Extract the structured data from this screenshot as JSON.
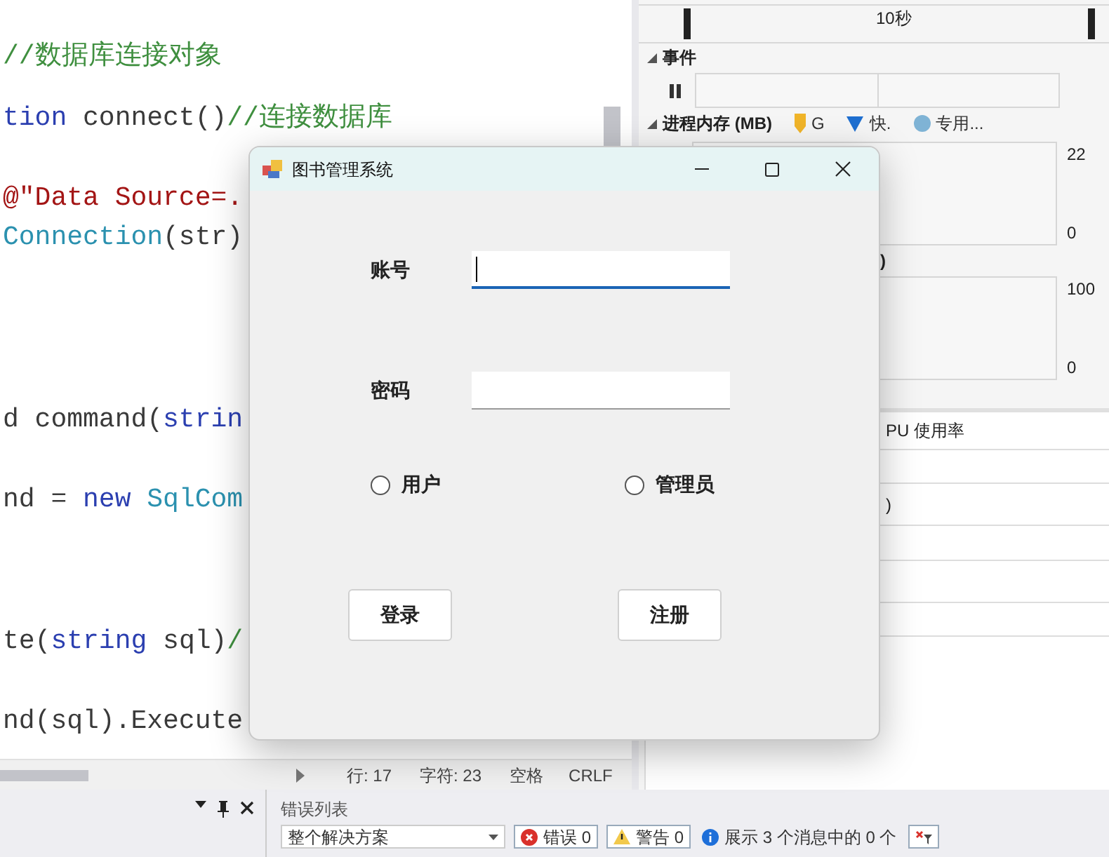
{
  "editor": {
    "lines": [
      {
        "tokens": [
          {
            "kind": "comment",
            "text": "//数据库连接对象"
          }
        ]
      },
      {
        "tokens": [
          {
            "kind": "keyword",
            "text": "tion"
          },
          {
            "kind": "plain",
            "text": " connect()"
          },
          {
            "kind": "comment",
            "text": "//连接数据库"
          }
        ]
      },
      {
        "tokens": [
          {
            "kind": "string",
            "text": "@\"Data Source=."
          }
        ]
      },
      {
        "tokens": [
          {
            "kind": "type",
            "text": "Connection"
          },
          {
            "kind": "plain",
            "text": "(str)"
          }
        ]
      },
      {
        "tokens": [
          {
            "kind": "plain",
            "text": "d command("
          },
          {
            "kind": "keyword",
            "text": "strin"
          }
        ]
      },
      {
        "tokens": [
          {
            "kind": "plain",
            "text": "nd = "
          },
          {
            "kind": "keyword",
            "text": "new"
          },
          {
            "kind": "type",
            "text": " SqlCom"
          }
        ]
      },
      {
        "tokens": [
          {
            "kind": "plain",
            "text": "te("
          },
          {
            "kind": "keyword",
            "text": "string"
          },
          {
            "kind": "plain",
            "text": " sql)"
          },
          {
            "kind": "comment",
            "text": "/"
          }
        ]
      },
      {
        "tokens": [
          {
            "kind": "plain",
            "text": "nd(sql).Execute"
          }
        ]
      }
    ],
    "status": {
      "line": "行: 17",
      "column": "字符: 23",
      "indent": "空格",
      "line_ending": "CRLF"
    }
  },
  "diagnostics": {
    "timeline_label": "10秒",
    "events_title": "事件",
    "memory_title": "进程内存 (MB)",
    "legend": [
      {
        "kind": "gc",
        "label": "G",
        "color": "#f0b429"
      },
      {
        "kind": "snapshot",
        "label": "快.",
        "color": "#1f6fd0"
      },
      {
        "kind": "private",
        "label": "专用...",
        "color": "#7fb3d5"
      }
    ],
    "memory_axis": [
      "22",
      "0"
    ],
    "cpu_title": ")",
    "cpu_axis": [
      "100",
      "0"
    ],
    "cpu_usage_title": "PU 使用率",
    "row_fragment": ")"
  },
  "bottom": {
    "error_list_title": "错误列表",
    "scope": "整个解决方案",
    "errors": "错误 0",
    "warnings": "警告 0",
    "messages": "展示 3 个消息中的 0 个"
  },
  "dialog": {
    "title": "图书管理系统",
    "fields": [
      {
        "label": "账号",
        "focused": true
      },
      {
        "label": "密码",
        "focused": false
      }
    ],
    "radios": [
      {
        "label": "用户",
        "selected": false
      },
      {
        "label": "管理员",
        "selected": false
      }
    ],
    "buttons": [
      "登录",
      "注册"
    ]
  }
}
